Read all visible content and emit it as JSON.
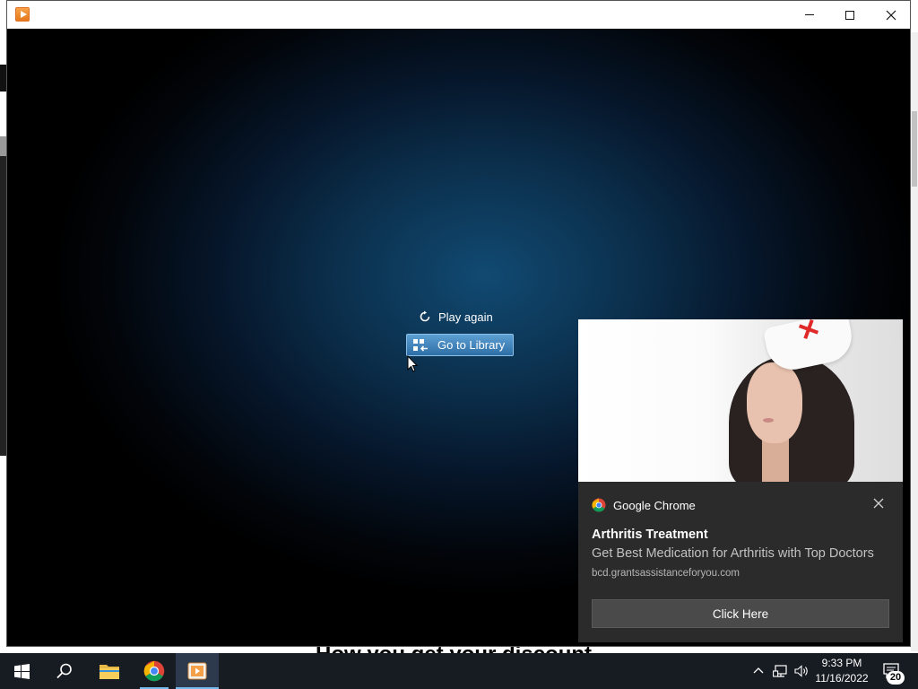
{
  "background_page": {
    "headline_fragment": "How you get your discount"
  },
  "player": {
    "controls": {
      "play_again": "Play again",
      "go_to_library": "Go to Library"
    }
  },
  "notification": {
    "app_name": "Google Chrome",
    "title": "Arthritis Treatment",
    "body": "Get Best Medication for Arthritis with Top Doctors",
    "url": "bcd.grantsassistanceforyou.com",
    "action_label": "Click Here"
  },
  "taskbar": {
    "pinned": [
      "start-icon",
      "search-icon",
      "file-explorer-icon",
      "chrome-icon",
      "media-player-icon"
    ],
    "time": "9:33 PM",
    "date": "11/16/2022",
    "notification_count": "20"
  },
  "colors": {
    "taskbar": "#171b22",
    "accent": "#76b9ed",
    "notification_bg": "#2b2b2b",
    "library_button": "#2e6ea6"
  }
}
